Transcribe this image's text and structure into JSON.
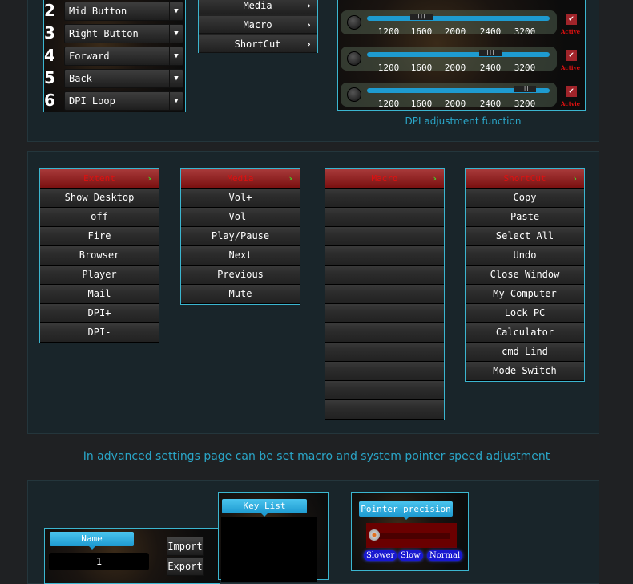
{
  "buttons": {
    "numbers": [
      "2",
      "3",
      "4",
      "5",
      "6"
    ],
    "items": [
      "Mid Button",
      "Right Button",
      "Forward",
      "Back",
      "DPI Loop"
    ]
  },
  "menu": {
    "items": [
      "Media",
      "Macro",
      "ShortCut"
    ]
  },
  "dpi": {
    "ticks": [
      "1200",
      "1600",
      "2000",
      "2400",
      "3200"
    ],
    "rows": [
      {
        "value": "1600",
        "active": "Active"
      },
      {
        "value": "2400",
        "active": "Active"
      },
      {
        "value": "3200",
        "active": "Actvie"
      }
    ],
    "caption": "DPI adjustment function"
  },
  "lists": [
    {
      "title": "Extent",
      "items": [
        "Show Desktop",
        "off",
        "Fire",
        "Browser",
        "Player",
        "Mail",
        "DPI+",
        "DPI-"
      ]
    },
    {
      "title": "Media",
      "items": [
        "Vol+",
        "Vol-",
        "Play/Pause",
        "Next",
        "Previous",
        "Mute"
      ]
    },
    {
      "title": "Macro",
      "items": [
        "",
        "",
        "",
        "",
        "",
        "",
        "",
        "",
        "",
        "",
        "",
        ""
      ]
    },
    {
      "title": "ShortCut",
      "items": [
        "Copy",
        "Paste",
        "Select All",
        "Undo",
        "Close Window",
        "My Computer",
        "Lock PC",
        "Calculator",
        "cmd Lind",
        "Mode Switch"
      ]
    }
  ],
  "advanced_caption": "In advanced settings page can be set macro and system pointer speed adjustment",
  "macro": {
    "name_label": "Name",
    "name_value": "1",
    "import": "Import",
    "export": "Export",
    "key_list": "Key List"
  },
  "pointer": {
    "label": "Pointer precision",
    "speeds": [
      "Slower",
      "Slow",
      "Normal"
    ],
    "level": 0
  },
  "colors": {
    "accent": "#3bb6d0",
    "header_red": "#e01010",
    "track": "#1e9bd0"
  }
}
